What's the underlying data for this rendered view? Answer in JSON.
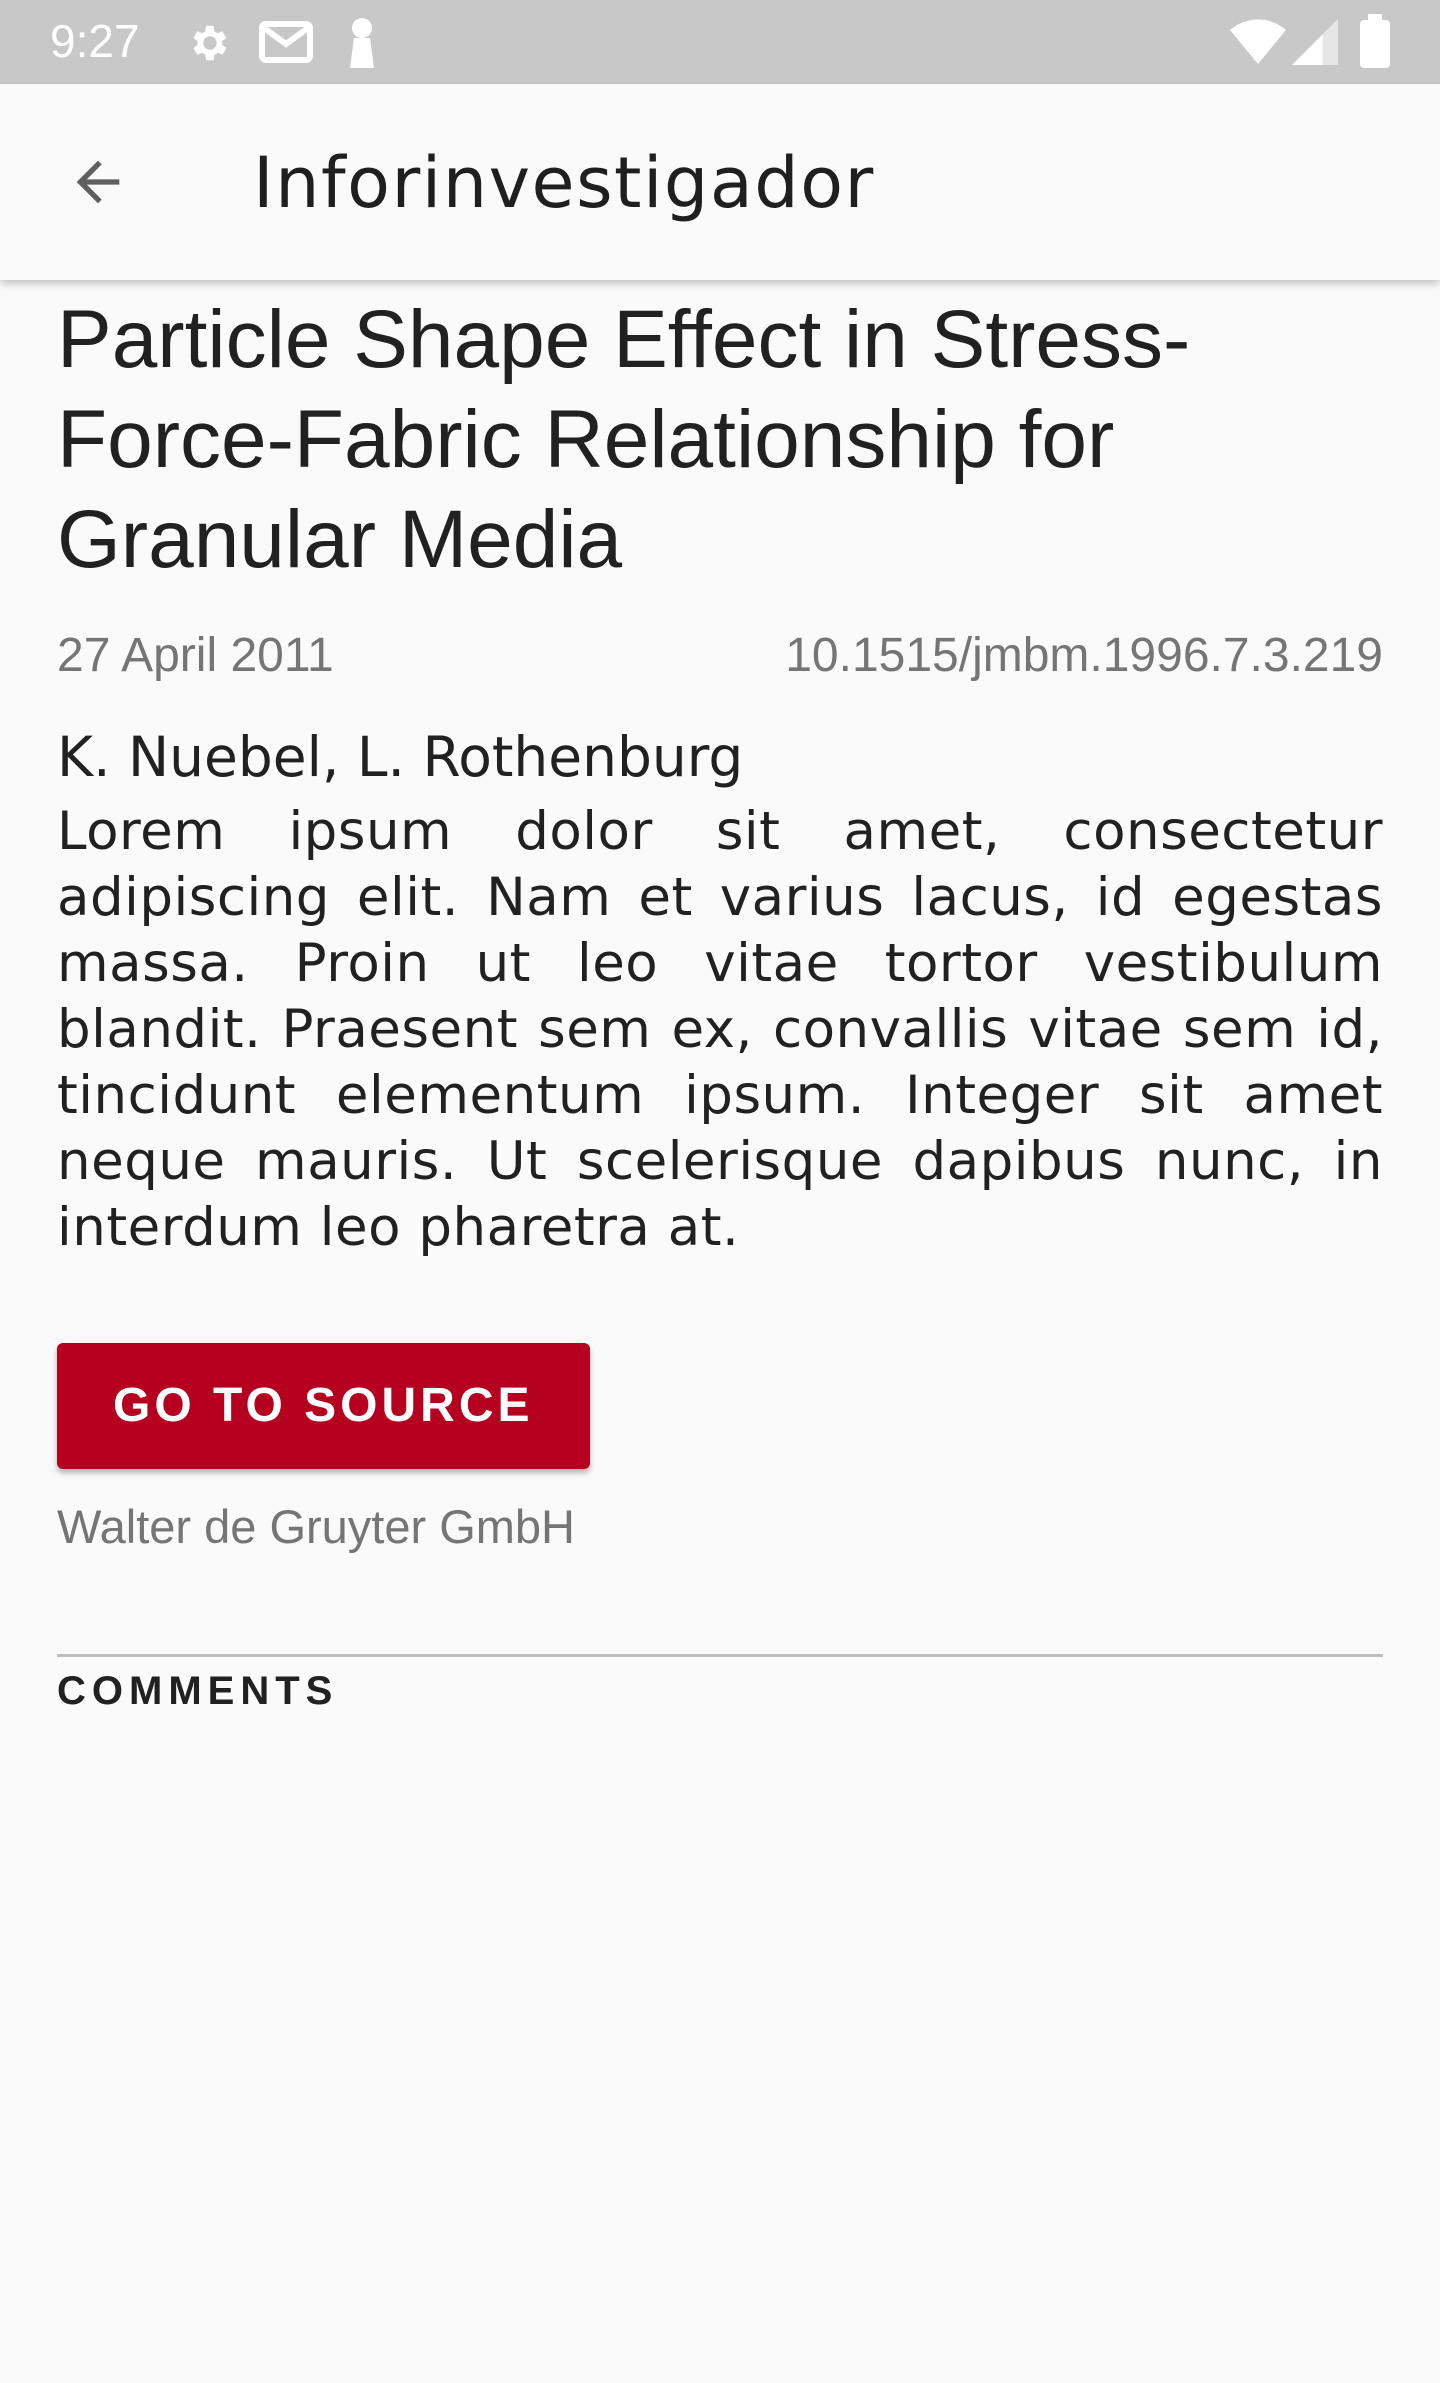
{
  "status_bar": {
    "time": "9:27",
    "icons": [
      "gear-icon",
      "mail-icon",
      "key-icon",
      "wifi-icon",
      "signal-icon",
      "battery-icon"
    ]
  },
  "app_bar": {
    "back_icon": "arrow-left-icon",
    "title": "Inforinvestigador"
  },
  "article": {
    "title": "Particle Shape Effect in Stress-Force-Fabric Relationship for Granular Media",
    "date": "27 April 2011",
    "doi": "10.1515/jmbm.1996.7.3.219",
    "authors": "K. Nuebel, L. Rothenburg",
    "abstract": "Lorem ipsum dolor sit amet, consectetur adipiscing elit. Nam et varius lacus, id egestas massa. Proin ut leo vitae tortor vestibulum blandit. Praesent sem ex, convallis vitae sem id, tincidunt elementum ipsum. Integer sit amet neque mauris. Ut scelerisque dapibus nunc, in interdum leo pharetra at.",
    "source_button_label": "GO TO SOURCE",
    "publisher": "Walter de Gruyter GmbH"
  },
  "comments": {
    "header": "COMMENTS"
  },
  "colors": {
    "accent": "#b5001f",
    "status_bar": "#c8c8c8",
    "background": "#fafafa",
    "muted_text": "#757575"
  }
}
